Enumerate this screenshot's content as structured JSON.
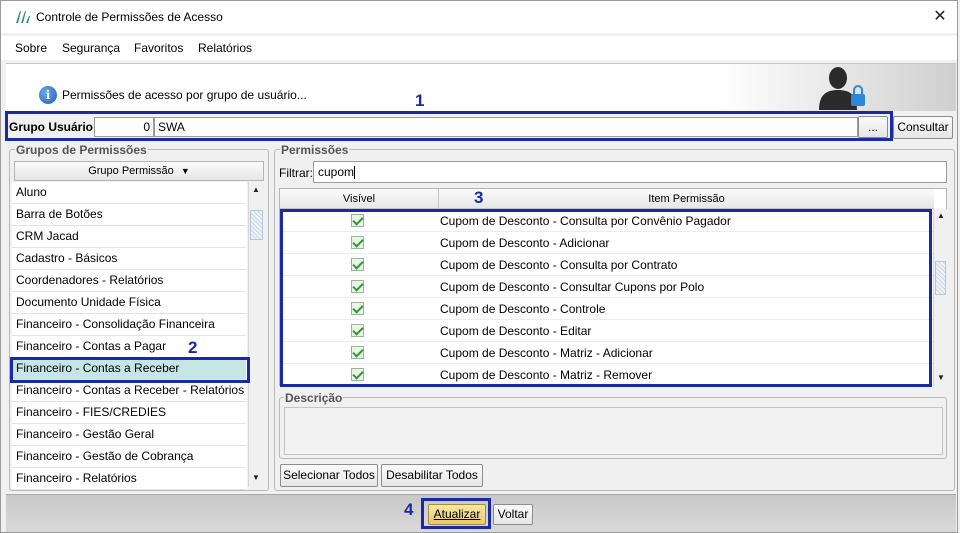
{
  "window": {
    "title": "Controle de Permissões de Acesso",
    "close_glyph": "✕"
  },
  "menu": [
    "Sobre",
    "Segurança",
    "Favoritos",
    "Relatórios"
  ],
  "banner": {
    "text": "Permissões de acesso por grupo de usuário...",
    "info_glyph": "i"
  },
  "steps": [
    "1",
    "2",
    "3",
    "4"
  ],
  "grupo_usuario": {
    "label": "Grupo Usuário:",
    "code": "0",
    "name": "SWA",
    "browse_label": "...",
    "consultar_label": "Consultar"
  },
  "grupos": {
    "title": "Grupos de Permissões",
    "column_header": "Grupo Permissão",
    "sort_glyph": "▼",
    "items": [
      "Aluno",
      "Barra de Botões",
      "CRM Jacad",
      "Cadastro - Básicos",
      "Coordenadores - Relatórios",
      "Documento Unidade Física",
      "Financeiro - Consolidação Financeira",
      "Financeiro - Contas a Pagar",
      "Financeiro - Contas a Receber",
      "Financeiro - Contas a Receber - Relatórios",
      "Financeiro - FIES/CREDIES",
      "Financeiro - Gestão Geral",
      "Financeiro - Gestão de Cobrança",
      "Financeiro - Relatórios"
    ],
    "selected_index": 8
  },
  "permissoes": {
    "title": "Permissões",
    "filter_label": "Filtrar:",
    "filter_value": "cupom",
    "col_visivel": "Visível",
    "col_item": "Item Permissão",
    "rows": [
      "Cupom de Desconto -  Consulta por Convênio Pagador",
      "Cupom de Desconto - Adicionar",
      "Cupom de Desconto - Consulta por Contrato",
      "Cupom de Desconto - Consultar Cupons por Polo",
      "Cupom de Desconto - Controle",
      "Cupom de Desconto - Editar",
      "Cupom de Desconto - Matriz - Adicionar",
      "Cupom de Desconto - Matriz - Remover"
    ],
    "descricao_title": "Descrição",
    "selecionar_todos": "Selecionar Todos",
    "desabilitar_todos": "Desabilitar Todos"
  },
  "footer": {
    "atualizar": "Atualizar",
    "voltar": "Voltar"
  },
  "colors": {
    "accent_box": "#1a2aa6",
    "selected_row": "#c6e6e6",
    "check": "#2e9a2e"
  }
}
